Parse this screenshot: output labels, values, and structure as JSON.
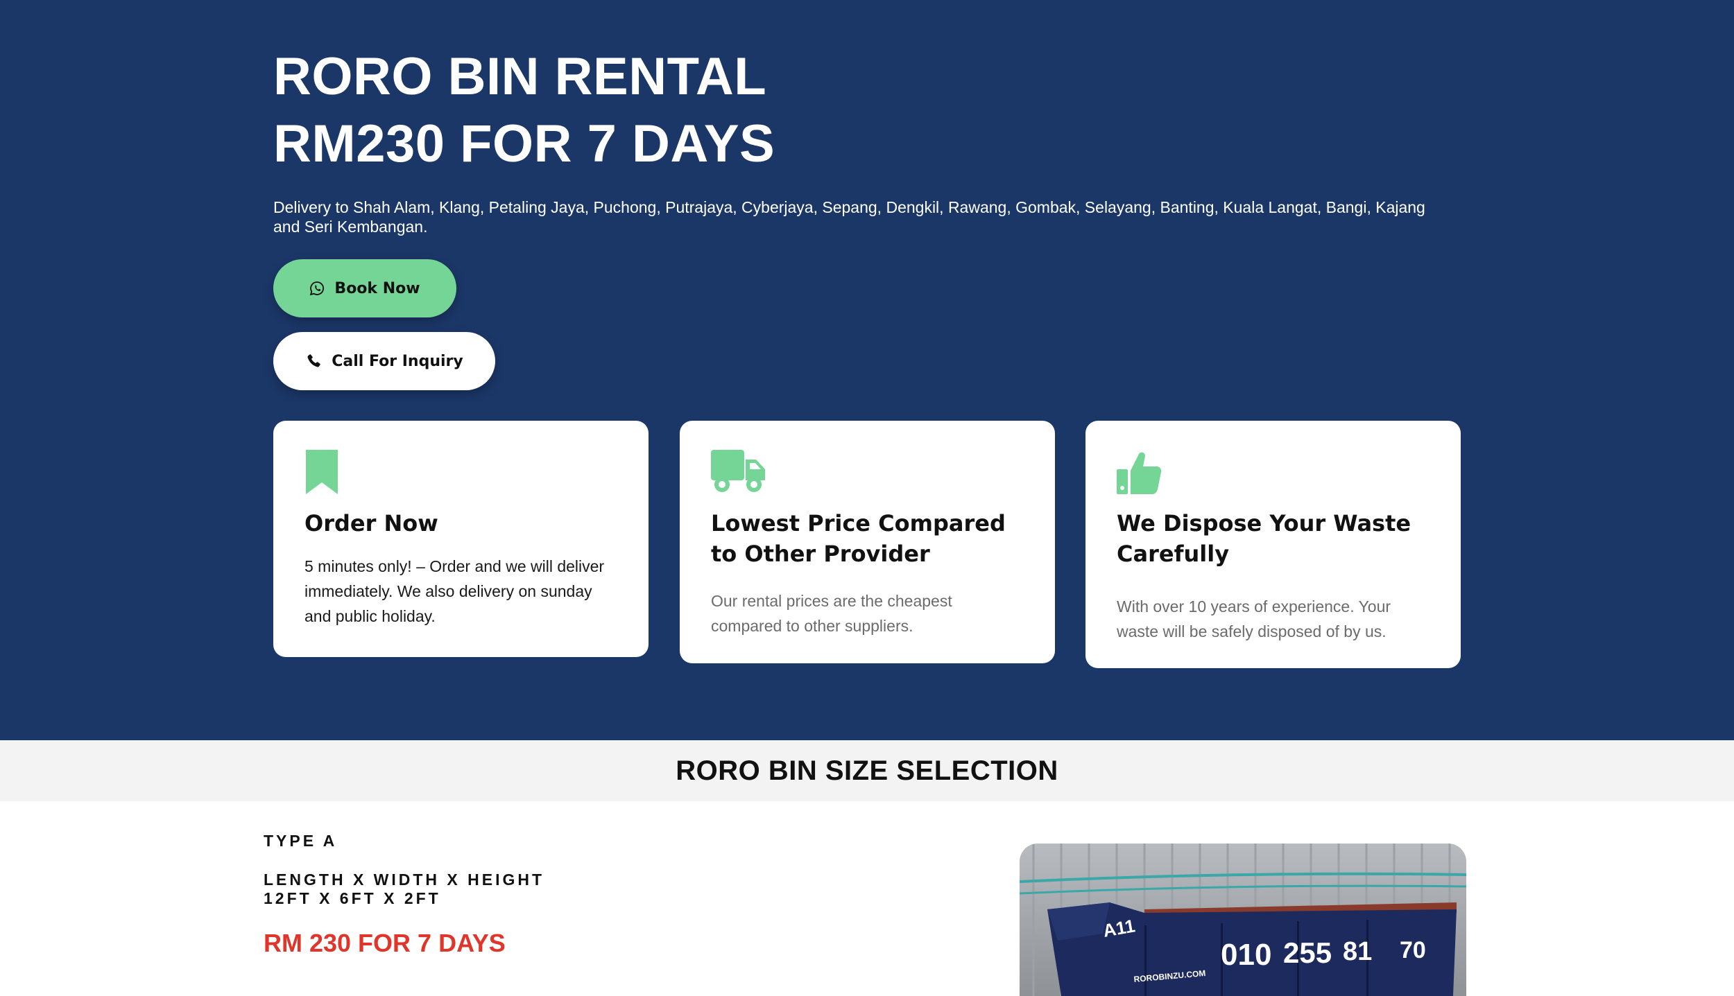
{
  "hero": {
    "title_line1": "RORO BIN RENTAL",
    "title_line2": "RM230 FOR 7 DAYS",
    "delivery_text": "Delivery to Shah Alam, Klang, Petaling Jaya, Puchong, Putrajaya, Cyberjaya, Sepang, Dengkil, Rawang, Gombak, Selayang, Banting, Kuala Langat, Bangi, Kajang and Seri Kembangan.",
    "book_button": {
      "label": "Book Now",
      "icon": "whatsapp-icon"
    },
    "call_button": {
      "label": "Call For Inquiry",
      "icon": "phone-icon"
    }
  },
  "features": [
    {
      "icon": "bookmark-icon",
      "title": "Order Now",
      "text": "5 minutes only! – Order and we will deliver immediately. We also delivery on sunday and public holiday."
    },
    {
      "icon": "truck-icon",
      "title": "Lowest Price Compared to Other Provider",
      "text": "Our rental prices are the cheapest compared to other suppliers."
    },
    {
      "icon": "thumbs-up-icon",
      "title": "We Dispose Your Waste Carefully",
      "text": "With over 10 years of experience. Your waste will be safely disposed of by us."
    }
  ],
  "size_section": {
    "title": "RORO BIN SIZE SELECTION",
    "type_label": "TYPE A",
    "dims_label": "LENGTH X WIDTH X HEIGHT",
    "dims_value": "12FT X 6FT X 2FT",
    "price": "RM 230 FOR 7 DAYS",
    "photo": {
      "bin_code": "A11",
      "phone_parts": [
        "010",
        "255",
        "81",
        "70"
      ],
      "brand": "ROROBINZU.COM"
    }
  },
  "colors": {
    "hero_bg": "#1b3768",
    "accent_green": "#74d596",
    "price_red": "#e0352b",
    "band_bg": "#f3f3f3"
  }
}
